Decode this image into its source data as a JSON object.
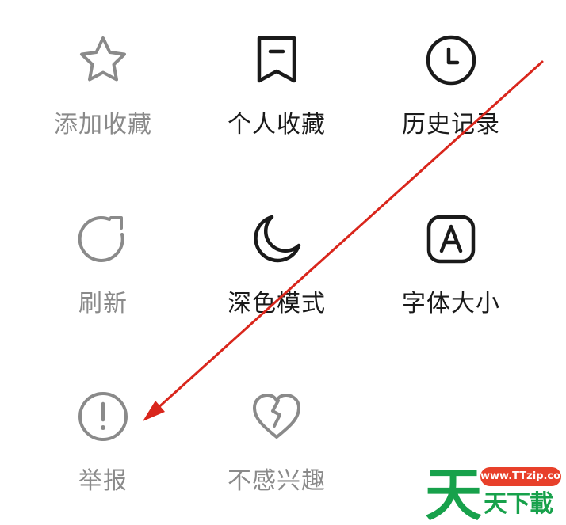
{
  "menu": {
    "items": [
      {
        "label": "添加收藏",
        "icon": "star-icon",
        "state": "disabled"
      },
      {
        "label": "个人收藏",
        "icon": "bookmark-icon",
        "state": "enabled"
      },
      {
        "label": "历史记录",
        "icon": "clock-icon",
        "state": "enabled"
      },
      {
        "label": "刷新",
        "icon": "refresh-icon",
        "state": "disabled"
      },
      {
        "label": "深色模式",
        "icon": "moon-icon",
        "state": "enabled"
      },
      {
        "label": "字体大小",
        "icon": "font-size-icon",
        "state": "enabled"
      },
      {
        "label": "举报",
        "icon": "report-icon",
        "state": "disabled"
      },
      {
        "label": "不感兴趣",
        "icon": "broken-heart-icon",
        "state": "disabled"
      }
    ]
  },
  "annotation": {
    "arrow_color": "#d9261c"
  },
  "watermark": {
    "url": "www.TTzip.com",
    "logo_glyph": "天",
    "text": "天下載",
    "colors": {
      "green": "#17a14b",
      "red": "#e8402a"
    }
  },
  "colors": {
    "icon_disabled": "#8a8a8a",
    "icon_enabled": "#1a1a1a"
  }
}
